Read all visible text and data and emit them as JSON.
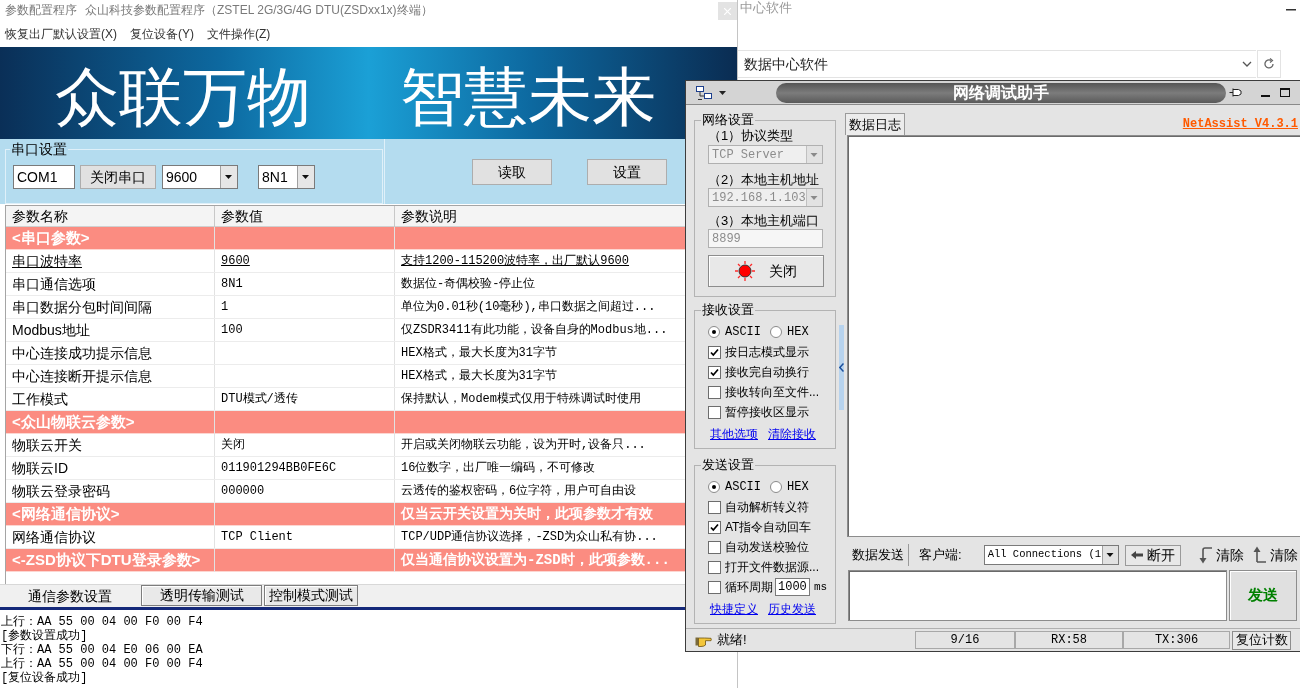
{
  "config_window": {
    "title": "参数配置程序",
    "subtitle": "众山科技参数配置程序（ZSTEL 2G/3G/4G DTU(ZSDxx1x)终端）",
    "menu": [
      "恢复出厂默认设置(X)",
      "复位设备(Y)",
      "文件操作(Z)"
    ],
    "banner": [
      "众联万物",
      "智慧未来"
    ],
    "serial_settings": {
      "title": "串口设置",
      "port": "COM1",
      "port_button": "关闭串口",
      "baud_rate": "9600",
      "frame_format": "8N1"
    },
    "buttons": [
      "读取",
      "设置"
    ],
    "table": {
      "columns": [
        "参数名称",
        "参数值",
        "参数说明"
      ],
      "rows": [
        {
          "kind": "section",
          "name": "<串口参数>",
          "selected": false
        },
        {
          "kind": "param",
          "name": "串口波特率",
          "value": "9600",
          "description": "支持1200-115200波特率，出厂默认9600",
          "selected": true
        },
        {
          "kind": "param",
          "name": "串口通信选项",
          "value": "8N1",
          "description": "数据位-奇偶校验-停止位",
          "selected": false
        },
        {
          "kind": "param",
          "name": "串口数据分包时间间隔",
          "value": "1",
          "description": "单位为0.01秒(10毫秒),串口数据之间超过...",
          "selected": false
        },
        {
          "kind": "param",
          "name": "Modbus地址",
          "value": "100",
          "description": "仅ZSDR3411有此功能，设备自身的Modbus地...",
          "selected": false
        },
        {
          "kind": "param",
          "name": "中心连接成功提示信息",
          "description": "HEX格式，最大长度为31字节",
          "selected": false
        },
        {
          "kind": "param",
          "name": "中心连接断开提示信息",
          "description": "HEX格式，最大长度为31字节",
          "selected": false
        },
        {
          "kind": "param",
          "name": "工作模式",
          "value": "DTU模式/透传",
          "description": "保持默认，Modem模式仅用于特殊调试时使用",
          "selected": false
        },
        {
          "kind": "section",
          "name": "<众山物联云参数>",
          "selected": false
        },
        {
          "kind": "param",
          "name": "物联云开关",
          "value": "关闭",
          "description": "开启或关闭物联云功能，设为开时,设备只...",
          "selected": false
        },
        {
          "kind": "param",
          "name": "物联云ID",
          "value": "011901294BB0FE6C",
          "description": "16位数字，出厂唯一编码，不可修改",
          "selected": false
        },
        {
          "kind": "param",
          "name": "物联云登录密码",
          "value": "000000",
          "description": "云透传的鉴权密码，6位字符，用户可自由设",
          "selected": false
        },
        {
          "kind": "section",
          "name": "<网络通信协议>",
          "description": "仅当云开关设置为关时，此项参数才有效",
          "selected": false
        },
        {
          "kind": "param",
          "name": "网络通信协议",
          "value": "TCP Client",
          "description": "TCP/UDP通信协议选择，-ZSD为众山私有协...",
          "selected": false
        },
        {
          "kind": "section",
          "name": "<-ZSD协议下DTU登录参数>",
          "description": "仅当通信协议设置为-ZSD时，此项参数...",
          "selected": false
        }
      ]
    },
    "tabs": [
      {
        "label": "通信参数设置",
        "selected": true
      },
      {
        "label": "透明传输测试",
        "selected": false
      },
      {
        "label": "控制模式测试",
        "selected": false
      }
    ],
    "log": [
      "上行：AA 55 00 04 00 F0 00 F4",
      "[参数设置成功]",
      "下行：AA 55 00 04 E0 06 00 EA",
      "上行：AA 55 00 04 00 F0 00 F4",
      "[复位设备成功]"
    ]
  },
  "browser_window": {
    "title": "中心软件",
    "address": "数据中心软件"
  },
  "netassist": {
    "title": "网络调试助手",
    "network": {
      "title": "网络设置",
      "fields": [
        {
          "label": "（1）协议类型",
          "kind": "select",
          "value": "TCP Server",
          "disabled": true
        },
        {
          "label": "（2）本地主机地址",
          "kind": "select",
          "value": "192.168.1.103",
          "disabled": true
        },
        {
          "label": "（3）本地主机端口",
          "kind": "input",
          "value": "8899",
          "disabled": true
        }
      ],
      "toggle": {
        "label": "关闭",
        "on": true
      }
    },
    "receive": {
      "title": "接收设置",
      "modes": [
        {
          "label": "ASCII",
          "selected": true
        },
        {
          "label": "HEX",
          "selected": false
        }
      ],
      "options": [
        {
          "kind": "check",
          "label": "按日志模式显示",
          "checked": true
        },
        {
          "kind": "check",
          "label": "接收完自动换行",
          "checked": true
        },
        {
          "kind": "check",
          "label": "接收转向至文件...",
          "checked": false
        },
        {
          "kind": "check",
          "label": "暂停接收区显示",
          "checked": false
        }
      ],
      "links": [
        "其他选项",
        "清除接收"
      ]
    },
    "send": {
      "title": "发送设置",
      "modes": [
        {
          "label": "ASCII",
          "selected": true
        },
        {
          "label": "HEX",
          "selected": false
        }
      ],
      "options": [
        {
          "kind": "check",
          "label": "自动解析转义符",
          "checked": false
        },
        {
          "kind": "check",
          "label": "AT指令自动回车",
          "checked": true
        },
        {
          "kind": "check",
          "label": "自动发送校验位",
          "checked": false
        },
        {
          "kind": "check",
          "label": "打开文件数据源...",
          "checked": false
        },
        {
          "kind": "period",
          "label": "循环周期",
          "checked": false,
          "value": "1000",
          "unit": "ms"
        }
      ],
      "links": [
        "快捷定义",
        "历史发送"
      ]
    },
    "log_tab": "数据日志",
    "version": "NetAssist V4.3.1",
    "send_tab": "数据发送",
    "client_label": "客户端:",
    "client_select": "All Connections (1",
    "disconnect_button": "断开",
    "clear_buttons": [
      "清除",
      "清除"
    ],
    "send_button": "发送",
    "status": {
      "message": "就绪!",
      "counters": [
        "9/16",
        "RX:58",
        "TX:306"
      ],
      "reset_button": "复位计数"
    }
  }
}
